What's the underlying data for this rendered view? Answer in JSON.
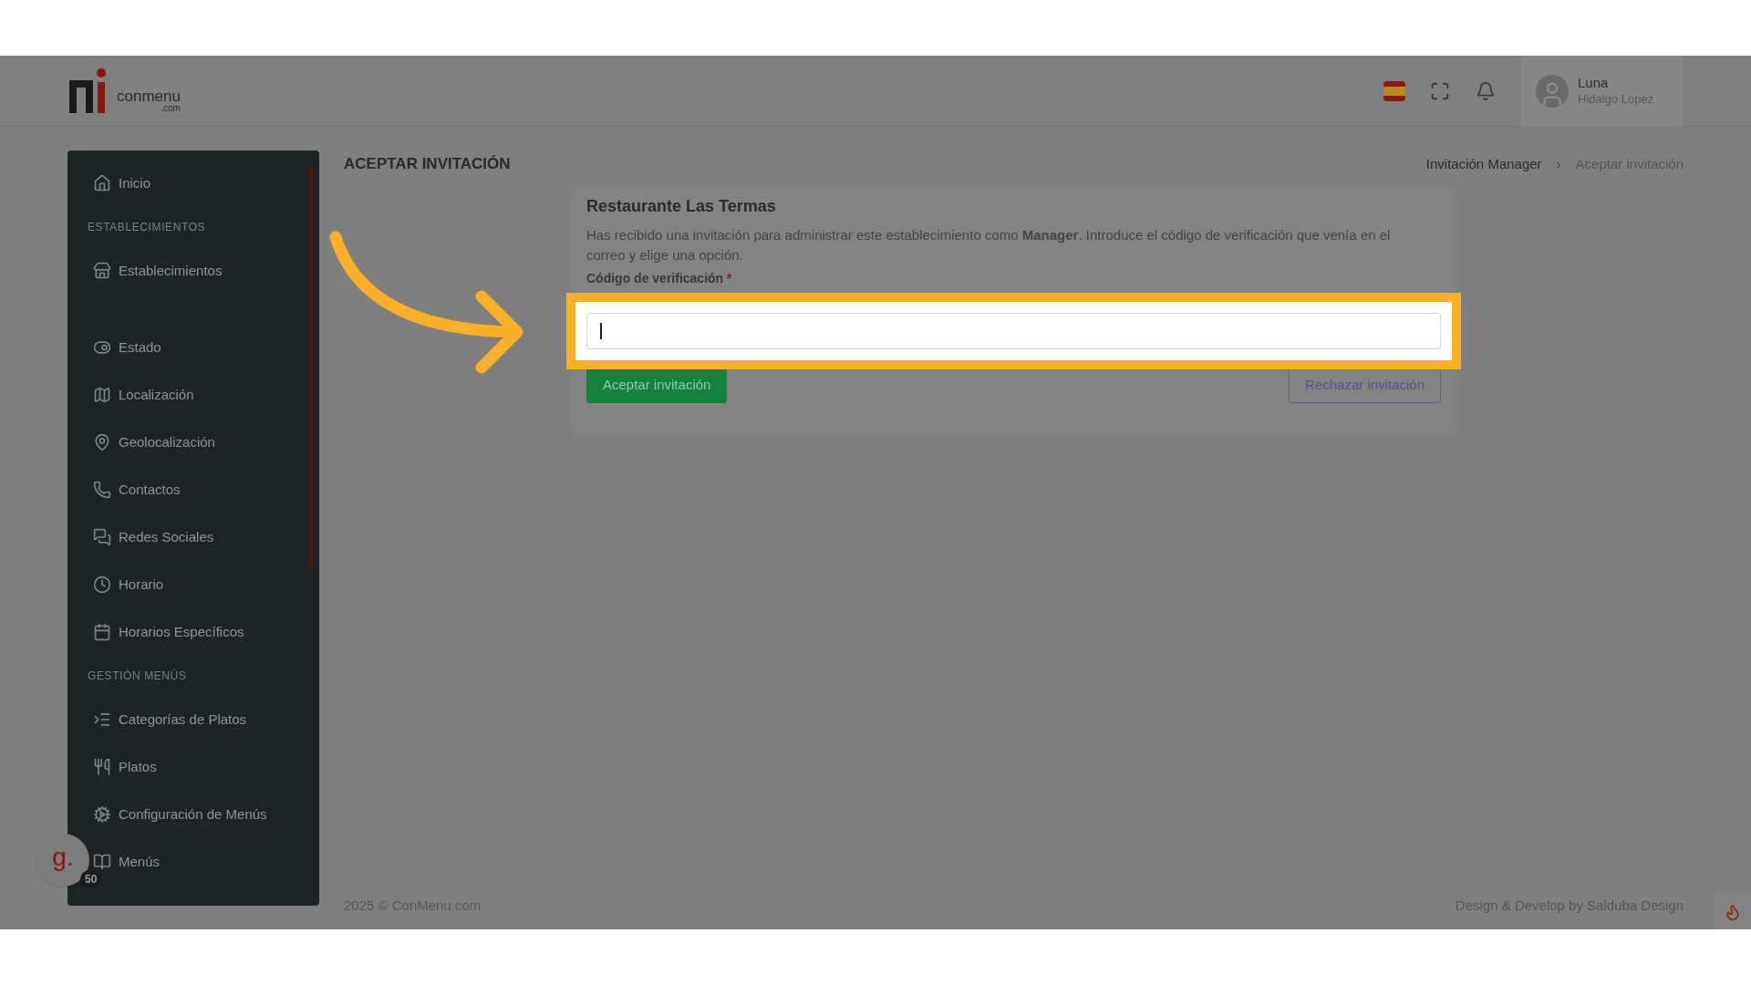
{
  "logo": {
    "text": "conmenu",
    "domain": ".com"
  },
  "header": {
    "user": {
      "name": "Luna",
      "surname": "Hidalgo Lopez"
    }
  },
  "sidebar": {
    "items": [
      {
        "kind": "link",
        "label": "Inicio"
      },
      {
        "kind": "section",
        "label": "ESTABLECIMIENTOS"
      },
      {
        "kind": "link",
        "label": "Establecimientos"
      },
      {
        "kind": "spacer"
      },
      {
        "kind": "link",
        "label": "Estado"
      },
      {
        "kind": "link",
        "label": "Localización"
      },
      {
        "kind": "link",
        "label": "Geolocalización"
      },
      {
        "kind": "link",
        "label": "Contactos"
      },
      {
        "kind": "link",
        "label": "Redes Sociales"
      },
      {
        "kind": "link",
        "label": "Horario"
      },
      {
        "kind": "link",
        "label": "Horarios Específicos"
      },
      {
        "kind": "section",
        "label": "GESTIÓN MENÚS"
      },
      {
        "kind": "link",
        "label": "Categorías de Platos"
      },
      {
        "kind": "link",
        "label": "Platos"
      },
      {
        "kind": "link",
        "label": "Configuración de Menús"
      },
      {
        "kind": "link",
        "label": "Menús"
      }
    ]
  },
  "page": {
    "title": "ACEPTAR INVITACIÓN",
    "breadcrumbs": [
      {
        "label": "Invitación Manager",
        "selected": false
      },
      {
        "label": "Aceptar invitación",
        "selected": true
      }
    ],
    "separator": "›"
  },
  "card": {
    "title": "Restaurante Las Termas",
    "description": "Has recibido una invitación para administrar este establecimiento como **Manager**. Introduce el código de verificación que venía en el correo y elige una opción.",
    "field": {
      "label": "Código de verificación",
      "required_mark": "*",
      "focused": true,
      "highlighted": true
    },
    "buttons": [
      {
        "kind": "primary",
        "label": "Aceptar invitación"
      },
      {
        "kind": "outline",
        "label": "Rechazar invitación"
      }
    ]
  },
  "footer": {
    "left": "2025 © ConMenu.com",
    "right": "Design & Develop by Salduba Design"
  },
  "widget": {
    "letter": "g.",
    "count": "50"
  }
}
